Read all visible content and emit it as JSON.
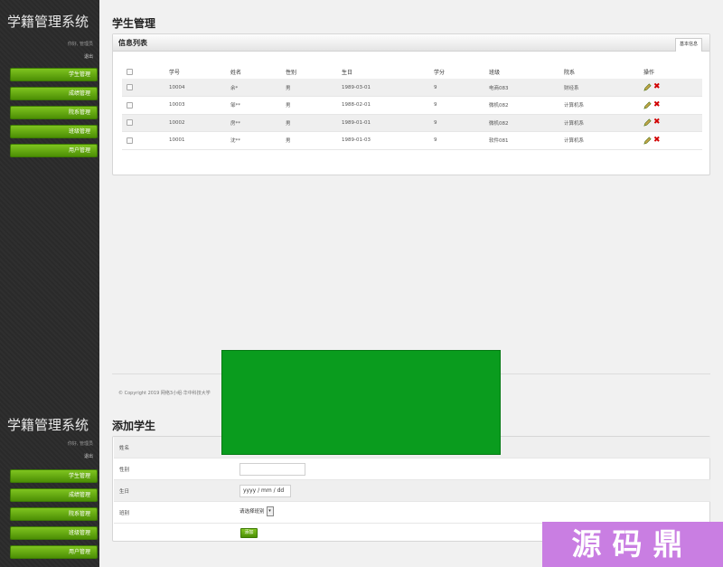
{
  "app_title": "学籍管理系统",
  "greeting": "你好, 管理员",
  "logout": "退出",
  "menu": [
    "学生管理",
    "成绩管理",
    "院系管理",
    "班级管理",
    "用户管理"
  ],
  "list_page": {
    "title": "学生管理",
    "panel_title": "信息列表",
    "tab_label": "基本信息",
    "columns": [
      "学号",
      "姓名",
      "性别",
      "生日",
      "学分",
      "班级",
      "院系",
      "操作"
    ],
    "rows": [
      {
        "id": "10004",
        "name": "余*",
        "sex": "男",
        "birthday": "1989-03-01",
        "credit": "9",
        "class": "电商083",
        "dept": "财经系"
      },
      {
        "id": "10003",
        "name": "邹**",
        "sex": "男",
        "birthday": "1988-02-01",
        "credit": "9",
        "class": "微机082",
        "dept": "计算机系"
      },
      {
        "id": "10002",
        "name": "房**",
        "sex": "男",
        "birthday": "1989-01-01",
        "credit": "9",
        "class": "微机082",
        "dept": "计算机系"
      },
      {
        "id": "10001",
        "name": "沈**",
        "sex": "男",
        "birthday": "1989-01-03",
        "credit": "9",
        "class": "软件081",
        "dept": "计算机系"
      }
    ],
    "footer": "© Copyright 2019 网络3小组·华中科技大学"
  },
  "add_page": {
    "title": "添加学生",
    "fields": {
      "name_label": "姓名",
      "sex_label": "性别",
      "birthday_label": "生日",
      "birthday_placeholder": "yyyy / mm / dd",
      "class_label": "班别",
      "class_select": "请选择班别"
    },
    "submit_label": "添加"
  },
  "watermark": "源码鼎",
  "colors": {
    "menu_green": "#5aa30d",
    "overlay_green": "#0a9c1e",
    "watermark_purple": "#c97ee2",
    "delete_red": "#d10000"
  }
}
